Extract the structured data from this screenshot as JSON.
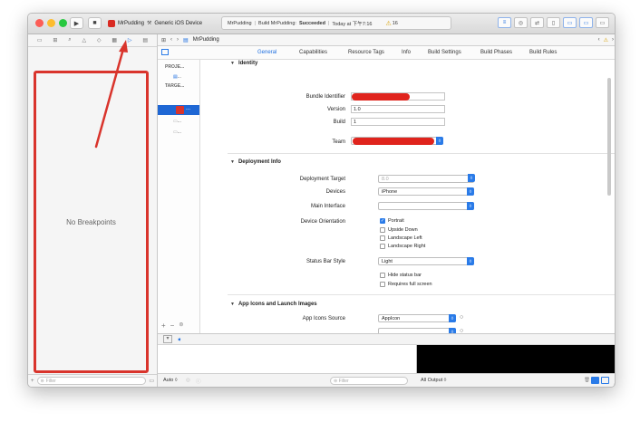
{
  "toolbar": {
    "run_icon": "▶",
    "stop_icon": "■",
    "scheme_name": "MrPudding",
    "device_name": "Generic iOS Device",
    "status_project": "MrPudding",
    "status_build_prefix": "Build MrPudding:",
    "status_build_result": "Succeeded",
    "status_time": "Today at 下午7:16",
    "warning_count": "16",
    "colors": {
      "accent": "#1e6fe0",
      "close": "#fc5d56",
      "minimize": "#fdbc2e",
      "zoom": "#28c840"
    }
  },
  "navigator": {
    "tab_icons": [
      "folder-icon",
      "hierarchy-icon",
      "search-icon",
      "warning-icon",
      "test-icon",
      "debug-icon",
      "breakpoint-icon",
      "report-icon"
    ],
    "empty_message": "No Breakpoints",
    "filter_placeholder": "Filter"
  },
  "editor": {
    "breadcrumb": "MrPudding",
    "tabs": [
      "General",
      "Capabilities",
      "Resource Tags",
      "Info",
      "Build Settings",
      "Build Phases",
      "Build Rules"
    ],
    "active_tab": "General",
    "target_list": {
      "project_header": "PROJE...",
      "targets_header": "TARGE...",
      "ellipsis": "..."
    }
  },
  "identity": {
    "title": "Identity",
    "bundle_identifier_label": "Bundle Identifier",
    "version_label": "Version",
    "version_value": "1.0",
    "build_label": "Build",
    "build_value": "1",
    "team_label": "Team"
  },
  "deployment": {
    "title": "Deployment Info",
    "target_label": "Deployment Target",
    "target_value": "8.0",
    "devices_label": "Devices",
    "devices_value": "iPhone",
    "main_interface_label": "Main Interface",
    "main_interface_value": "",
    "orientation_label": "Device Orientation",
    "orientations": [
      {
        "label": "Portrait",
        "checked": true
      },
      {
        "label": "Upside Down",
        "checked": false
      },
      {
        "label": "Landscape Left",
        "checked": false
      },
      {
        "label": "Landscape Right",
        "checked": false
      }
    ],
    "status_bar_label": "Status Bar Style",
    "status_bar_value": "Light",
    "hide_status_bar": "Hide status bar",
    "requires_full_screen": "Requires full screen"
  },
  "app_icons": {
    "title": "App Icons and Launch Images",
    "icons_source_label": "App Icons Source",
    "icons_source_value": "AppIcon"
  },
  "debug": {
    "auto_label": "Auto ◊",
    "filter_placeholder": "Filter",
    "output_label": "All Output ◊"
  }
}
